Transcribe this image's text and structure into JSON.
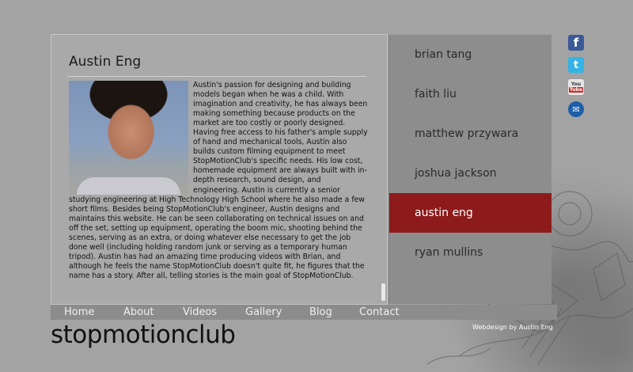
{
  "article": {
    "title": "Austin Eng",
    "bio": "Austin's passion for designing and building models began when he was a child. With imagination and creativity, he has always been making something because products on the market are too costly or poorly designed. Having free access to his father's ample supply of hand and mechanical tools, Austin also builds custom filming equipment to meet StopMotionClub's specific needs. His low cost, homemade equipment are always built with in-depth research, sound design, and engineering. Austin is currently a senior studying engineering at High Technology High School where he also made a few short films. Besides being StopMotionClub's engineer, Austin designs and maintains this website. He can be seen collaborating on technical issues on and off the set, setting up equipment, operating the boom mic, shooting behind the scenes, serving as an extra, or doing whatever else necessary to get the job done well (including holding random junk or serving as a temporary human tripod). Austin has had an amazing time producing videos with Brian, and although he feels the name StopMotionClub doesn't quite fit, he figures that the name has a story. After all, telling stories is the main goal of StopMotionClub."
  },
  "members": [
    {
      "label": "brian tang",
      "active": false
    },
    {
      "label": "faith liu",
      "active": false
    },
    {
      "label": "matthew przywara",
      "active": false
    },
    {
      "label": "joshua jackson",
      "active": false
    },
    {
      "label": "austin eng",
      "active": true
    },
    {
      "label": "ryan mullins",
      "active": false
    }
  ],
  "social": {
    "facebook_glyph": "f",
    "twitter_glyph": "t",
    "youtube_top": "You",
    "youtube_bottom": "Tube",
    "mail_glyph": "✉"
  },
  "menu": [
    "Home",
    "About",
    "Videos",
    "Gallery",
    "Blog",
    "Contact"
  ],
  "brand": "stopmotionclub",
  "credit": "Webdesign by Austin Eng",
  "colors": {
    "active_member_bg": "#8d1b1b",
    "nav_bg": "#8d8d8d",
    "page_bg": "#a3a3a3"
  }
}
